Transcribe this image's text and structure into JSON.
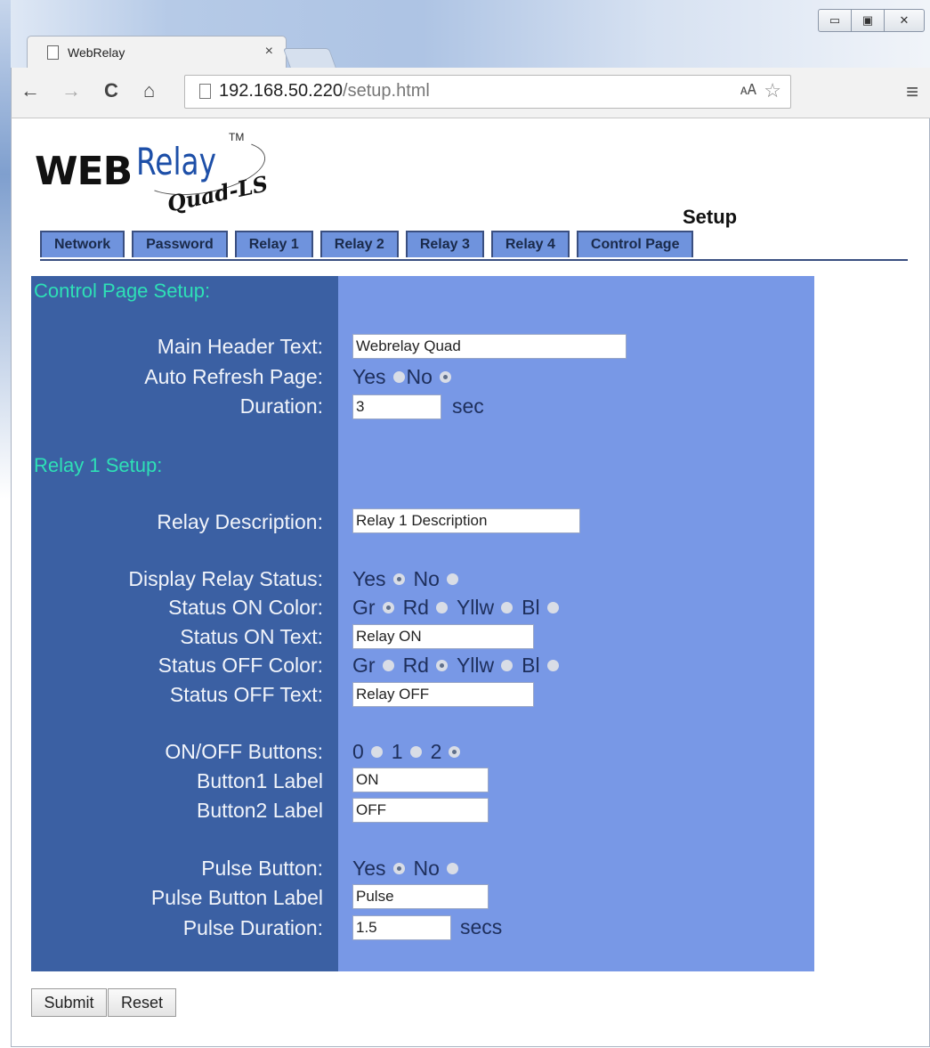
{
  "browser": {
    "tab_title": "WebRelay",
    "tab_close": "×",
    "url_host": "192.168.50.220",
    "url_path": "/setup.html",
    "back_icon": "←",
    "forward_icon": "→",
    "reload_icon": "C",
    "home_icon": "⌂",
    "menu_icon": "≡",
    "star_icon": "☆",
    "translate_icon": "🗚",
    "minimize_icon": "▭",
    "maximize_icon": "▣",
    "close_icon": "✕"
  },
  "logo": {
    "web": "WEB",
    "relay": "Relay",
    "tm": "TM",
    "model": "Quad-LS"
  },
  "page_title": "Setup",
  "tabs": [
    "Network",
    "Password",
    "Relay 1",
    "Relay 2",
    "Relay 3",
    "Relay 4",
    "Control Page"
  ],
  "control_page": {
    "section_title": "Control Page Setup:",
    "main_header_label": "Main Header Text:",
    "main_header_value": "Webrelay Quad",
    "auto_refresh_label": "Auto Refresh Page:",
    "auto_refresh_options": [
      "Yes",
      "No"
    ],
    "auto_refresh_selected": "No",
    "duration_label": "Duration:",
    "duration_value": "3",
    "duration_unit": "sec"
  },
  "relay1": {
    "section_title": "Relay 1 Setup:",
    "description_label": "Relay Description:",
    "description_value": "Relay 1 Description",
    "display_status_label": "Display Relay Status:",
    "display_status_options": [
      "Yes",
      "No"
    ],
    "display_status_selected": "Yes",
    "on_color_label": "Status ON Color:",
    "color_options": [
      "Gr",
      "Rd",
      "Yllw",
      "Bl"
    ],
    "on_color_selected": "Gr",
    "on_text_label": "Status ON Text:",
    "on_text_value": "Relay ON",
    "off_color_label": "Status OFF Color:",
    "off_color_selected": "Rd",
    "off_text_label": "Status OFF Text:",
    "off_text_value": "Relay OFF",
    "buttons_label": "ON/OFF Buttons:",
    "buttons_options": [
      "0",
      "1",
      "2"
    ],
    "buttons_selected": "2",
    "button1_label": "Button1 Label",
    "button1_value": "ON",
    "button2_label": "Button2 Label",
    "button2_value": "OFF",
    "pulse_label": "Pulse Button:",
    "pulse_options": [
      "Yes",
      "No"
    ],
    "pulse_selected": "Yes",
    "pulse_button_label": "Pulse Button Label",
    "pulse_button_value": "Pulse",
    "pulse_duration_label": "Pulse Duration:",
    "pulse_duration_value": "1.5",
    "pulse_duration_unit": "secs"
  },
  "actions": {
    "submit": "Submit",
    "reset": "Reset"
  },
  "colors": {
    "panel_left": "#3b60a3",
    "panel_right": "#7898e6",
    "section_title": "#2ee0b6",
    "tab_bg": "#6f93dd"
  }
}
